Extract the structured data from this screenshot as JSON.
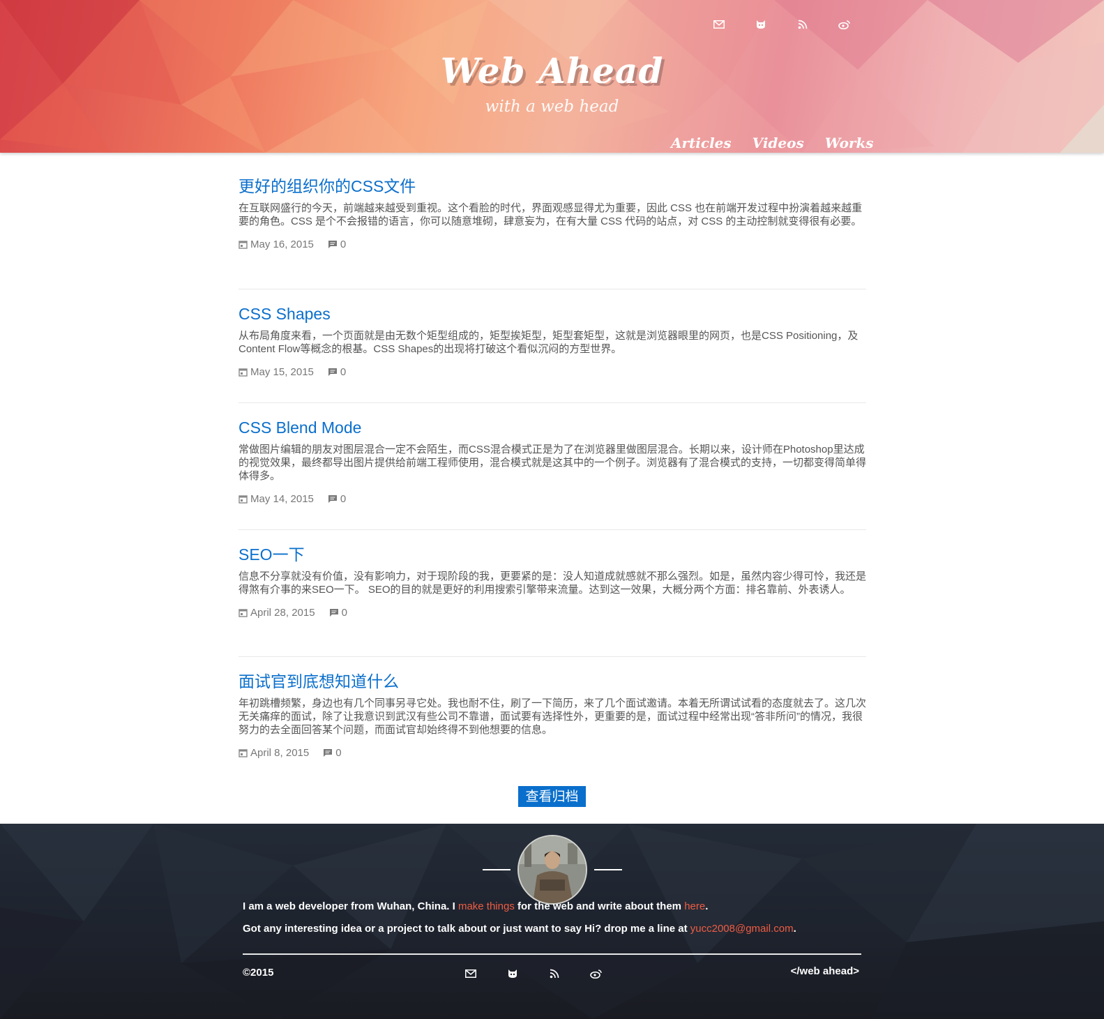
{
  "header": {
    "title": "Web Ahead",
    "subtitle": "with a web head",
    "icons": [
      "mail-icon",
      "github-icon",
      "rss-icon",
      "weibo-icon"
    ],
    "nav": [
      "Articles",
      "Videos",
      "Works"
    ]
  },
  "posts": [
    {
      "title": "更好的组织你的CSS文件",
      "excerpt": "在互联网盛行的今天，前端越来越受到重视。这个看脸的时代，界面观感显得尤为重要，因此 CSS 也在前端开发过程中扮演着越来越重要的角色。CSS 是个不会报错的语言，你可以随意堆砌，肆意妄为，在有大量 CSS 代码的站点，对 CSS 的主动控制就变得很有必要。",
      "date": "May 16, 2015",
      "comments": "0"
    },
    {
      "title": "CSS Shapes",
      "excerpt": "从布局角度来看，一个页面就是由无数个矩型组成的，矩型挨矩型，矩型套矩型，这就是浏览器眼里的网页，也是CSS Positioning，及Content Flow等概念的根基。CSS Shapes的出现将打破这个看似沉闷的方型世界。",
      "date": "May 15, 2015",
      "comments": "0"
    },
    {
      "title": "CSS Blend Mode",
      "excerpt": "常做图片编辑的朋友对图层混合一定不会陌生，而CSS混合模式正是为了在浏览器里做图层混合。长期以来，设计师在Photoshop里达成的视觉效果，最终都导出图片提供给前端工程师使用，混合模式就是这其中的一个例子。浏览器有了混合模式的支持，一切都变得简单得体得多。",
      "date": "May 14, 2015",
      "comments": "0"
    },
    {
      "title": "SEO一下",
      "excerpt": "信息不分享就没有价值，没有影响力，对于现阶段的我，更要紧的是：没人知道成就感就不那么强烈。如是，虽然内容少得可怜，我还是得煞有介事的来SEO一下。 SEO的目的就是更好的利用搜索引擎带来流量。达到这一效果，大概分两个方面：排名靠前、外表诱人。",
      "date": "April 28, 2015",
      "comments": "0"
    },
    {
      "title": "面试官到底想知道什么",
      "excerpt": "年初跳槽频繁，身边也有几个同事另寻它处。我也耐不住，刷了一下简历，来了几个面试邀请。本着无所谓试试看的态度就去了。这几次无关痛痒的面试，除了让我意识到武汉有些公司不靠谱，面试要有选择性外，更重要的是，面试过程中经常出现“答非所问”的情况，我很努力的去全面回答某个问题，而面试官却始终得不到他想要的信息。",
      "date": "April 8, 2015",
      "comments": "0"
    }
  ],
  "archive_button": "查看归档",
  "footer": {
    "line1_a": "I am a web developer from Wuhan, China. I ",
    "line1_link1": "make things",
    "line1_b": " for the web and write about them ",
    "line1_link2": "here",
    "line1_c": ".",
    "line2_a": "Got any interesting idea or a project to talk about or just want to say Hi? drop me a line at ",
    "line2_email": "yucc2008@gmail.com",
    "line2_c": ".",
    "copyright": "©2015",
    "brand": "</web ahead>",
    "icons": [
      "mail-icon",
      "github-icon",
      "rss-icon",
      "weibo-icon"
    ]
  },
  "colors": {
    "link": "#0a6fcc",
    "footer_link": "#ef5c43",
    "footer_bg": "#1d222c"
  }
}
